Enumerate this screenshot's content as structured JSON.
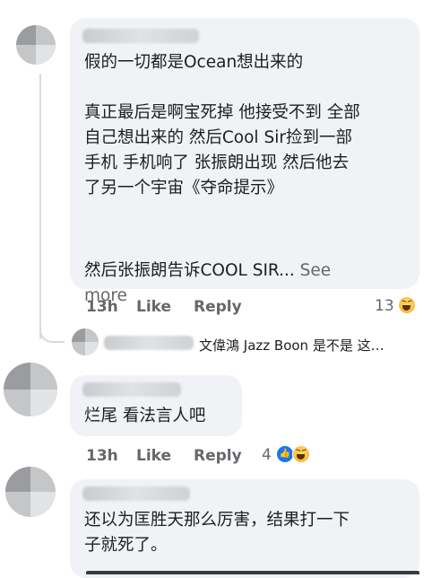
{
  "comments": [
    {
      "text_line1": "假的一切都是Ocean想出来的",
      "text_body": "真正最后是啊宝死掉 他接受不到 全部\n自己想出来的 然后Cool Sir捡到一部\n手机 手机响了 张振朗出现 然后他去\n了另一个宇宙《夺命提示》",
      "text_trunc": "然后张振朗告诉COOL SIR... ",
      "see_more": "See\nmore",
      "time": "13h",
      "like_label": "Like",
      "reply_label": "Reply",
      "reaction_count": "13",
      "reaction_icons": [
        "haha-icon"
      ]
    },
    {
      "text": "烂尾 看法言人吧",
      "time": "13h",
      "like_label": "Like",
      "reply_label": "Reply",
      "reaction_count": "4",
      "reaction_icons": [
        "like-icon",
        "haha-icon"
      ]
    },
    {
      "text": "还以为匡胜天那么厉害，结果打一下\n子就死了。"
    }
  ],
  "reply_preview": {
    "text": "文偉鴻 Jazz Boon 是不是 这…"
  },
  "colors": {
    "bubble": "#f0f2f5",
    "text": "#1c1e21",
    "secondary": "#65676b",
    "like_blue": "#1877f2",
    "haha_yellow": "#f7b125"
  }
}
